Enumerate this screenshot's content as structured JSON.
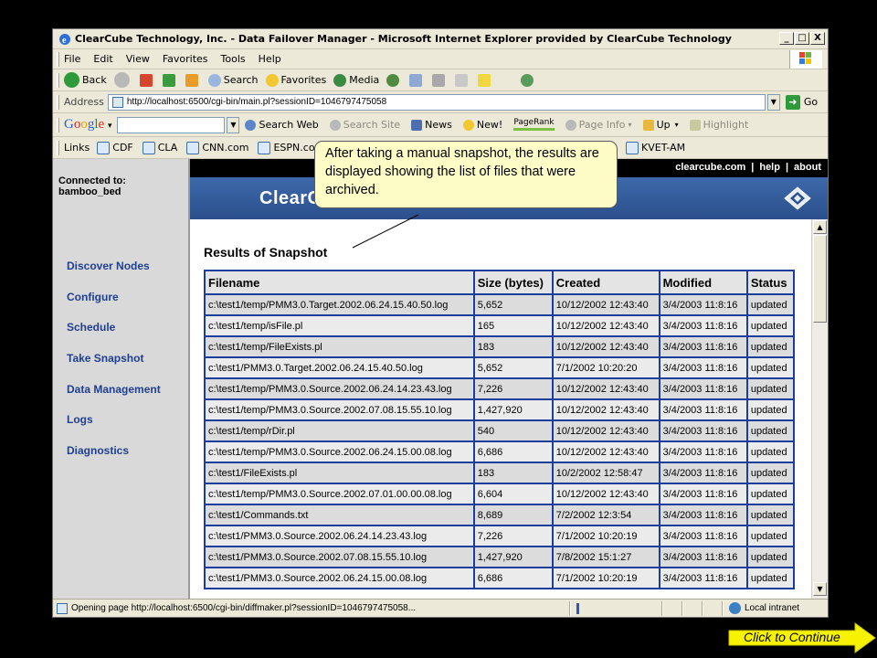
{
  "window": {
    "title": "ClearCube Technology, Inc. - Data Failover Manager - Microsoft Internet Explorer provided by ClearCube Technology",
    "minimize_glyph": "_",
    "maximize_glyph": "□",
    "close_glyph": "X"
  },
  "menu": {
    "items": [
      "File",
      "Edit",
      "View",
      "Favorites",
      "Tools",
      "Help"
    ]
  },
  "toolbar": {
    "back_label": "Back",
    "search_label": "Search",
    "favorites_label": "Favorites",
    "media_label": "Media"
  },
  "address_bar": {
    "label": "Address",
    "url": "http://localhost:6500/cgi-bin/main.pl?sessionID=1046797475058",
    "go_label": "Go"
  },
  "google_bar": {
    "search_web_label": "Search Web",
    "search_site_label": "Search Site",
    "news_label": "News",
    "new_label": "New!",
    "pagerank_label": "PageRank",
    "page_info_label": "Page Info",
    "up_label": "Up",
    "highlight_label": "Highlight"
  },
  "links_bar": {
    "label": "Links",
    "items": [
      "CDF",
      "CLA",
      "CNN.com",
      "ESPN.com"
    ],
    "right_item": "KVET-AM"
  },
  "page": {
    "connected_label": "Connected to:",
    "connected_host": "bamboo_bed",
    "nav": [
      "Discover Nodes",
      "Configure",
      "Schedule",
      "Take Snapshot",
      "Data Management",
      "Logs",
      "Diagnostics"
    ],
    "top_links": [
      "clearcube.com",
      "help",
      "about"
    ],
    "banner_text": "ClearC",
    "results_title": "Results of Snapshot"
  },
  "table": {
    "headers": [
      "Filename",
      "Size (bytes)",
      "Created",
      "Modified",
      "Status"
    ],
    "rows": [
      [
        "c:\\test1/temp/PMM3.0.Target.2002.06.24.15.40.50.log",
        "5,652",
        "10/12/2002 12:43:40",
        "3/4/2003 11:8:16",
        "updated"
      ],
      [
        "c:\\test1/temp/isFile.pl",
        "165",
        "10/12/2002 12:43:40",
        "3/4/2003 11:8:16",
        "updated"
      ],
      [
        "c:\\test1/temp/FileExists.pl",
        "183",
        "10/12/2002 12:43:40",
        "3/4/2003 11:8:16",
        "updated"
      ],
      [
        "c:\\test1/PMM3.0.Target.2002.06.24.15.40.50.log",
        "5,652",
        "7/1/2002 10:20:20",
        "3/4/2003 11:8:16",
        "updated"
      ],
      [
        "c:\\test1/temp/PMM3.0.Source.2002.06.24.14.23.43.log",
        "7,226",
        "10/12/2002 12:43:40",
        "3/4/2003 11:8:16",
        "updated"
      ],
      [
        "c:\\test1/temp/PMM3.0.Source.2002.07.08.15.55.10.log",
        "1,427,920",
        "10/12/2002 12:43:40",
        "3/4/2003 11:8:16",
        "updated"
      ],
      [
        "c:\\test1/temp/rDir.pl",
        "540",
        "10/12/2002 12:43:40",
        "3/4/2003 11:8:16",
        "updated"
      ],
      [
        "c:\\test1/temp/PMM3.0.Source.2002.06.24.15.00.08.log",
        "6,686",
        "10/12/2002 12:43:40",
        "3/4/2003 11:8:16",
        "updated"
      ],
      [
        "c:\\test1/FileExists.pl",
        "183",
        "10/2/2002 12:58:47",
        "3/4/2003 11:8:16",
        "updated"
      ],
      [
        "c:\\test1/temp/PMM3.0.Source.2002.07.01.00.00.08.log",
        "6,604",
        "10/12/2002 12:43:40",
        "3/4/2003 11:8:16",
        "updated"
      ],
      [
        "c:\\test1/Commands.txt",
        "8,689",
        "7/2/2002 12:3:54",
        "3/4/2003 11:8:16",
        "updated"
      ],
      [
        "c:\\test1/PMM3.0.Source.2002.06.24.14.23.43.log",
        "7,226",
        "7/1/2002 10:20:19",
        "3/4/2003 11:8:16",
        "updated"
      ],
      [
        "c:\\test1/PMM3.0.Source.2002.07.08.15.55.10.log",
        "1,427,920",
        "7/8/2002 15:1:27",
        "3/4/2003 11:8:16",
        "updated"
      ],
      [
        "c:\\test1/PMM3.0.Source.2002.06.24.15.00.08.log",
        "6,686",
        "7/1/2002 10:20:19",
        "3/4/2003 11:8:16",
        "updated"
      ]
    ]
  },
  "status_bar": {
    "text": "Opening page http://localhost:6500/cgi-bin/diffmaker.pl?sessionID=1046797475058...",
    "zone": "Local intranet"
  },
  "callout": {
    "text": "After taking a manual snapshot, the results are displayed showing the list of files that were archived."
  },
  "continue_button": {
    "label": "Click to Continue"
  },
  "colors": {
    "nav_link": "#1f3f8f",
    "banner": "#2b4f8c",
    "table_border": "#1a3f9a",
    "callout_bg": "#fdfcc6",
    "continue_bg": "#f7f200"
  }
}
